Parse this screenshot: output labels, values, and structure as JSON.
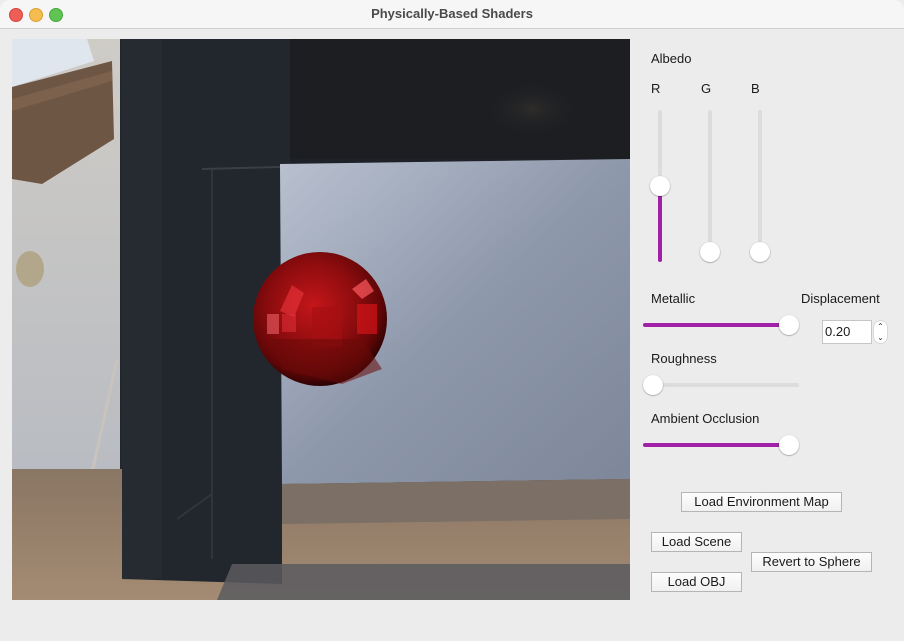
{
  "window": {
    "title": "Physically-Based Shaders"
  },
  "viewport": {
    "description": "Rendered red metallic sphere over studio environment map",
    "sphere_color": "#8e0a0a",
    "accent": "#a020a8"
  },
  "controls": {
    "albedo": {
      "label": "Albedo",
      "channels": [
        {
          "label": "R",
          "value": 0.5
        },
        {
          "label": "G",
          "value": 0.0
        },
        {
          "label": "B",
          "value": 0.0
        }
      ]
    },
    "metallic": {
      "label": "Metallic",
      "value": 1.0
    },
    "roughness": {
      "label": "Roughness",
      "value": 0.0
    },
    "ambient_occlusion": {
      "label": "Ambient Occlusion",
      "value": 1.0
    },
    "displacement": {
      "label": "Displacement",
      "value": "0.20",
      "up_icon": "⌃",
      "down_icon": "⌄"
    }
  },
  "buttons": {
    "load_env_map": "Load Environment Map",
    "load_scene": "Load Scene",
    "revert_to_sphere": "Revert to Sphere",
    "load_obj": "Load OBJ"
  }
}
